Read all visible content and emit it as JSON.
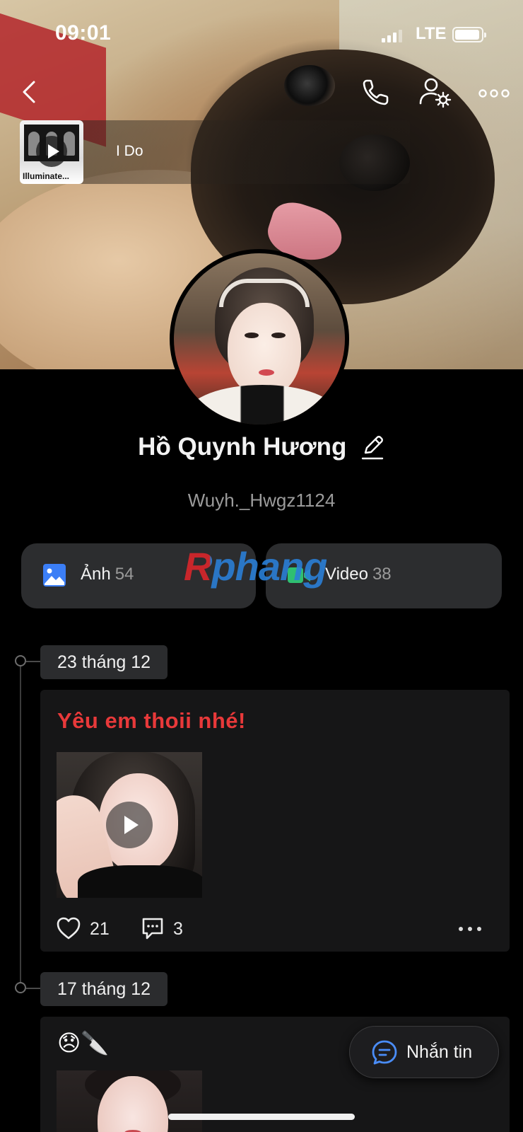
{
  "status_bar": {
    "time": "09:01",
    "network": "LTE"
  },
  "nav": {
    "back": "back-icon",
    "call": "phone-icon",
    "settings": "user-settings-icon",
    "more": "more-icon"
  },
  "music": {
    "song_title": "I Do",
    "album_caption": "Illuminate..."
  },
  "profile": {
    "name": "Hồ Quynh Hương",
    "username": "Wuyh._Hwgz1124"
  },
  "media_tabs": [
    {
      "label": "Ảnh",
      "count": "54",
      "icon": "photo-icon",
      "color": "#3b7ef6"
    },
    {
      "label": "Video",
      "count": "38",
      "icon": "video-icon",
      "color": "#2fbf71"
    }
  ],
  "watermark": {
    "text": "Rphang"
  },
  "timeline": [
    {
      "date": "23 tháng 12",
      "text": "Yêu em thoii nhé!",
      "text_color": "#e8393a",
      "has_video": true,
      "likes": "21",
      "comments": "3"
    },
    {
      "date": "17 tháng 12",
      "text": "😞🔪"
    }
  ],
  "floating_button": {
    "label": "Nhắn tin",
    "icon": "chat-icon",
    "icon_color": "#4a8df8"
  }
}
